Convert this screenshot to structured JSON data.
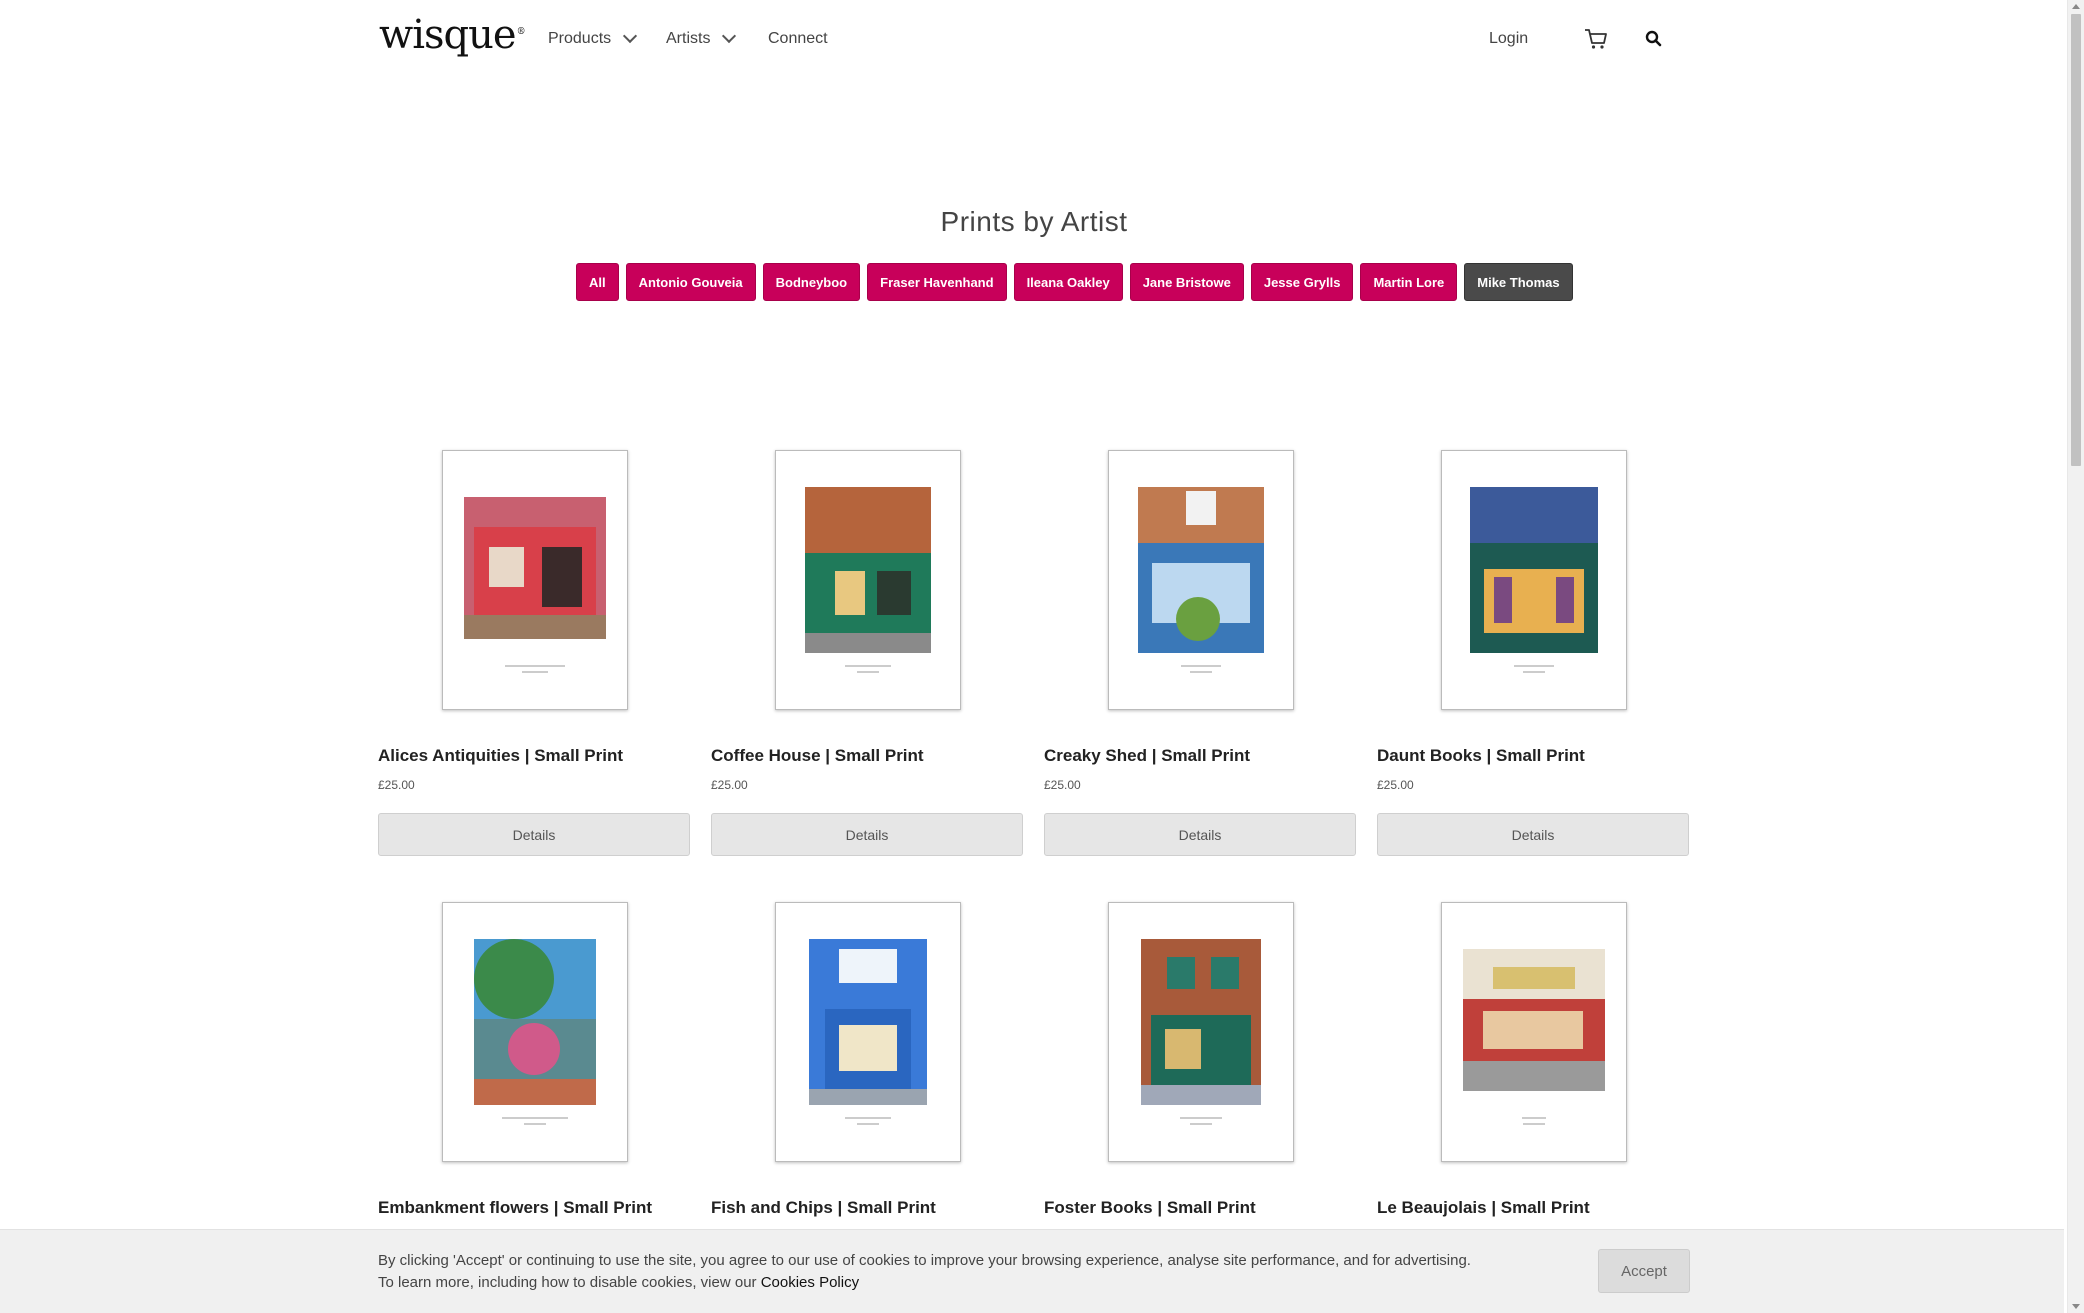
{
  "header": {
    "logo": "wisque",
    "logo_mark": "®",
    "nav": [
      {
        "label": "Products",
        "icon": "chevron-down-icon"
      },
      {
        "label": "Artists",
        "icon": "chevron-down-icon"
      },
      {
        "label": "Connect"
      }
    ],
    "login_label": "Login",
    "cart_icon": "cart-icon",
    "search_icon": "search-icon"
  },
  "page": {
    "title": "Prints by Artist"
  },
  "filters": [
    {
      "label": "All",
      "active": false
    },
    {
      "label": "Antonio Gouveia",
      "active": false
    },
    {
      "label": "Bodneyboo",
      "active": false
    },
    {
      "label": "Fraser Havenhand",
      "active": false
    },
    {
      "label": "Ileana Oakley",
      "active": false
    },
    {
      "label": "Jane Bristowe",
      "active": false
    },
    {
      "label": "Jesse Grylls",
      "active": false
    },
    {
      "label": "Martin Lore",
      "active": false
    },
    {
      "label": "Mike Thomas",
      "active": true
    }
  ],
  "products": [
    {
      "title": "Alices Antiquities | Small Print",
      "price": "£25.00",
      "button": "Details",
      "accent": "#d8404a",
      "sky": "#c86070"
    },
    {
      "title": "Coffee House | Small Print",
      "price": "£25.00",
      "button": "Details",
      "accent": "#1f7a5a",
      "sky": "#b5643c"
    },
    {
      "title": "Creaky Shed | Small Print",
      "price": "£25.00",
      "button": "Details",
      "accent": "#3a78b8",
      "sky": "#c07a50"
    },
    {
      "title": "Daunt Books | Small Print",
      "price": "£25.00",
      "button": "Details",
      "accent": "#1d5a52",
      "sky": "#3c5a9a"
    },
    {
      "title": "Embankment flowers | Small Print",
      "price": "",
      "button": "",
      "accent": "#3b8a4a",
      "sky": "#4a9ad0"
    },
    {
      "title": "Fish and Chips | Small Print",
      "price": "",
      "button": "",
      "accent": "#2a66c0",
      "sky": "#3a7ad8"
    },
    {
      "title": "Foster Books | Small Print",
      "price": "",
      "button": "",
      "accent": "#1e6a58",
      "sky": "#a85a3a"
    },
    {
      "title": "Le Beaujolais | Small Print",
      "price": "",
      "button": "",
      "accent": "#c0403a",
      "sky": "#d8c070"
    }
  ],
  "cookie": {
    "line1": "By clicking 'Accept' or continuing to use the site, you agree to our use of cookies to improve your browsing experience, analyse site performance, and for advertising.",
    "line2_prefix": "To learn more, including how to disable cookies, view our ",
    "link": "Cookies Policy",
    "accept_label": "Accept"
  },
  "colors": {
    "brand_pink": "#c8005a",
    "active_filter": "#4a4a4a",
    "button_grey": "#e6e6e6"
  }
}
